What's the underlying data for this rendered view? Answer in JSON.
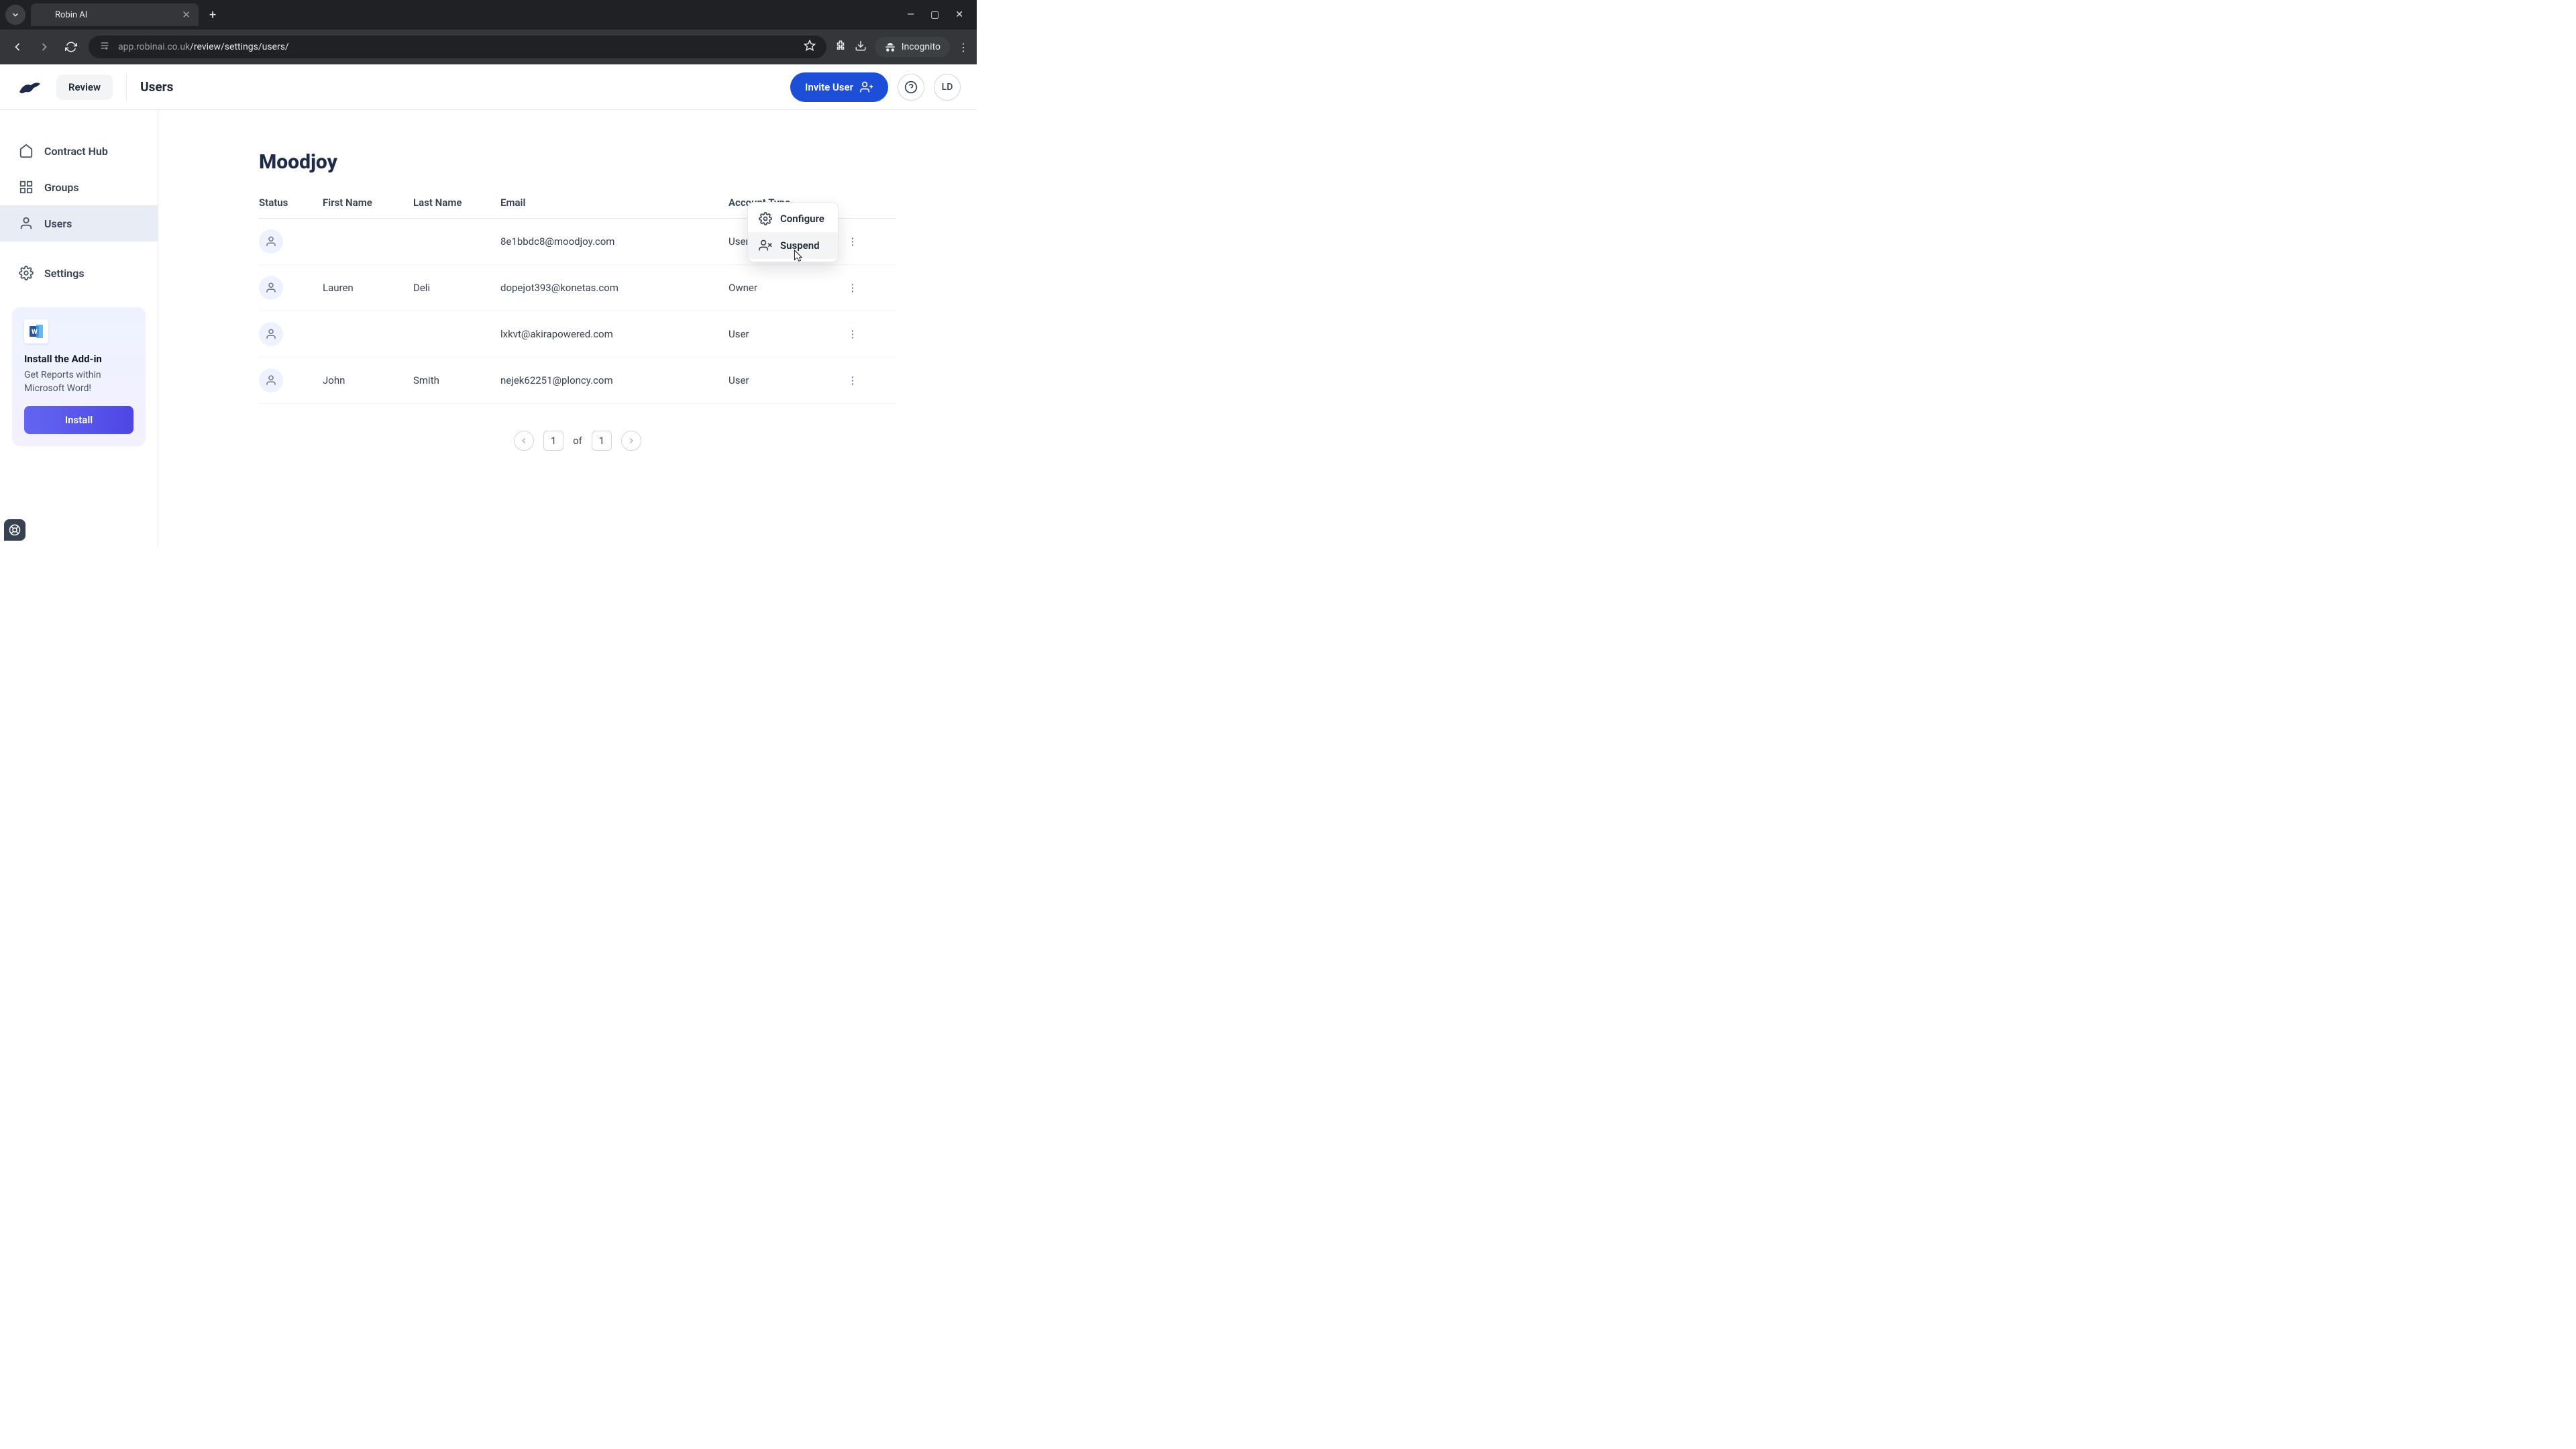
{
  "browser": {
    "tab_title": "Robin AI",
    "url_host": "app.robinai.co.uk",
    "url_path": "/review/settings/users/",
    "incognito_label": "Incognito"
  },
  "header": {
    "review_label": "Review",
    "page_title": "Users",
    "invite_label": "Invite User",
    "avatar_initials": "LD"
  },
  "sidebar": {
    "items": [
      {
        "label": "Contract Hub"
      },
      {
        "label": "Groups"
      },
      {
        "label": "Users"
      },
      {
        "label": "Settings"
      }
    ],
    "addon": {
      "title": "Install the Add-in",
      "subtitle": "Get Reports within Microsoft Word!",
      "install_label": "Install"
    }
  },
  "main": {
    "org_name": "Moodjoy",
    "columns": {
      "status": "Status",
      "first_name": "First Name",
      "last_name": "Last Name",
      "email": "Email",
      "account_type": "Account Type"
    },
    "rows": [
      {
        "first_name": "",
        "last_name": "",
        "email": "8e1bbdc8@moodjoy.com",
        "account_type": "User"
      },
      {
        "first_name": "Lauren",
        "last_name": "Deli",
        "email": "dopejot393@konetas.com",
        "account_type": "Owner"
      },
      {
        "first_name": "",
        "last_name": "",
        "email": "lxkvt@akirapowered.com",
        "account_type": "User"
      },
      {
        "first_name": "John",
        "last_name": "Smith",
        "email": "nejek62251@ploncy.com",
        "account_type": "User"
      }
    ],
    "context_menu": {
      "configure": "Configure",
      "suspend": "Suspend"
    },
    "pagination": {
      "current": "1",
      "of": "of",
      "total": "1"
    }
  }
}
